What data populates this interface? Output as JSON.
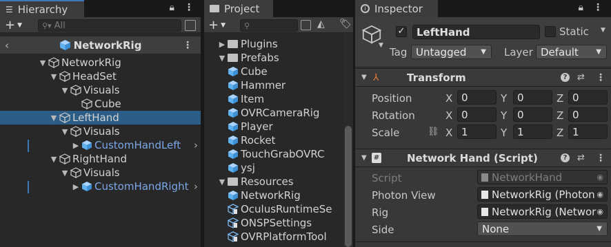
{
  "hierarchy": {
    "tab_label": "Hierarchy",
    "search_placeholder": "All",
    "scene_title": "NetworkRig",
    "items": [
      {
        "label": "NetworkRig",
        "depth": 0,
        "expanded": true,
        "prefab": false
      },
      {
        "label": "HeadSet",
        "depth": 1,
        "expanded": true,
        "prefab": false
      },
      {
        "label": "Visuals",
        "depth": 2,
        "expanded": true,
        "prefab": false
      },
      {
        "label": "Cube",
        "depth": 3,
        "expanded": null,
        "prefab": false
      },
      {
        "label": "LeftHand",
        "depth": 1,
        "expanded": true,
        "prefab": false,
        "selected": true
      },
      {
        "label": "Visuals",
        "depth": 2,
        "expanded": true,
        "prefab": false
      },
      {
        "label": "CustomHandLeft",
        "depth": 3,
        "expanded": false,
        "prefab": true
      },
      {
        "label": "RightHand",
        "depth": 1,
        "expanded": true,
        "prefab": false
      },
      {
        "label": "Visuals",
        "depth": 2,
        "expanded": true,
        "prefab": false
      },
      {
        "label": "CustomHandRight",
        "depth": 3,
        "expanded": false,
        "prefab": true
      }
    ]
  },
  "project": {
    "tab_label": "Project",
    "items": [
      {
        "label": "Plugins",
        "kind": "folder",
        "depth": 0,
        "expanded": false
      },
      {
        "label": "Prefabs",
        "kind": "folder-open",
        "depth": 0,
        "expanded": true
      },
      {
        "label": "Cube",
        "kind": "prefab",
        "depth": 1
      },
      {
        "label": "Hammer",
        "kind": "prefab",
        "depth": 1
      },
      {
        "label": "Item",
        "kind": "prefab",
        "depth": 1
      },
      {
        "label": "OVRCameraRig",
        "kind": "prefab",
        "depth": 1
      },
      {
        "label": "Player",
        "kind": "prefab",
        "depth": 1
      },
      {
        "label": "Rocket",
        "kind": "prefab",
        "depth": 1
      },
      {
        "label": "TouchGrabOVRC",
        "kind": "prefab",
        "depth": 1
      },
      {
        "label": "ysj",
        "kind": "prefab",
        "depth": 1
      },
      {
        "label": "Resources",
        "kind": "folder-open",
        "depth": 0,
        "expanded": true
      },
      {
        "label": "NetworkRig",
        "kind": "prefab",
        "depth": 1
      },
      {
        "label": "OculusRuntimeSe",
        "kind": "asset",
        "depth": 1
      },
      {
        "label": "ONSPSettings",
        "kind": "asset",
        "depth": 1
      },
      {
        "label": "OVRPlatformTool",
        "kind": "asset",
        "depth": 1
      }
    ]
  },
  "inspector": {
    "tab_label": "Inspector",
    "object_name": "LeftHand",
    "static_label": "Static",
    "tag_label": "Tag",
    "tag_value": "Untagged",
    "layer_label": "Layer",
    "layer_value": "Default",
    "transform": {
      "title": "Transform",
      "position_label": "Position",
      "rotation_label": "Rotation",
      "scale_label": "Scale",
      "x": "X",
      "y": "Y",
      "z": "Z",
      "position": [
        "0",
        "0",
        "0"
      ],
      "rotation": [
        "0",
        "0",
        "0"
      ],
      "scale": [
        "1",
        "1",
        "1"
      ]
    },
    "script_component": {
      "title": "Network Hand (Script)",
      "script_label": "Script",
      "script_value": "NetworkHand",
      "photon_label": "Photon View",
      "photon_value": "NetworkRig (Photon",
      "rig_label": "Rig",
      "rig_value": "NetworkRig (Networ",
      "side_label": "Side",
      "side_value": "None"
    }
  },
  "colors": {
    "accent": "#3a79bb",
    "selection": "#2c5d87",
    "prefab_blue": "#7ba7e8"
  }
}
